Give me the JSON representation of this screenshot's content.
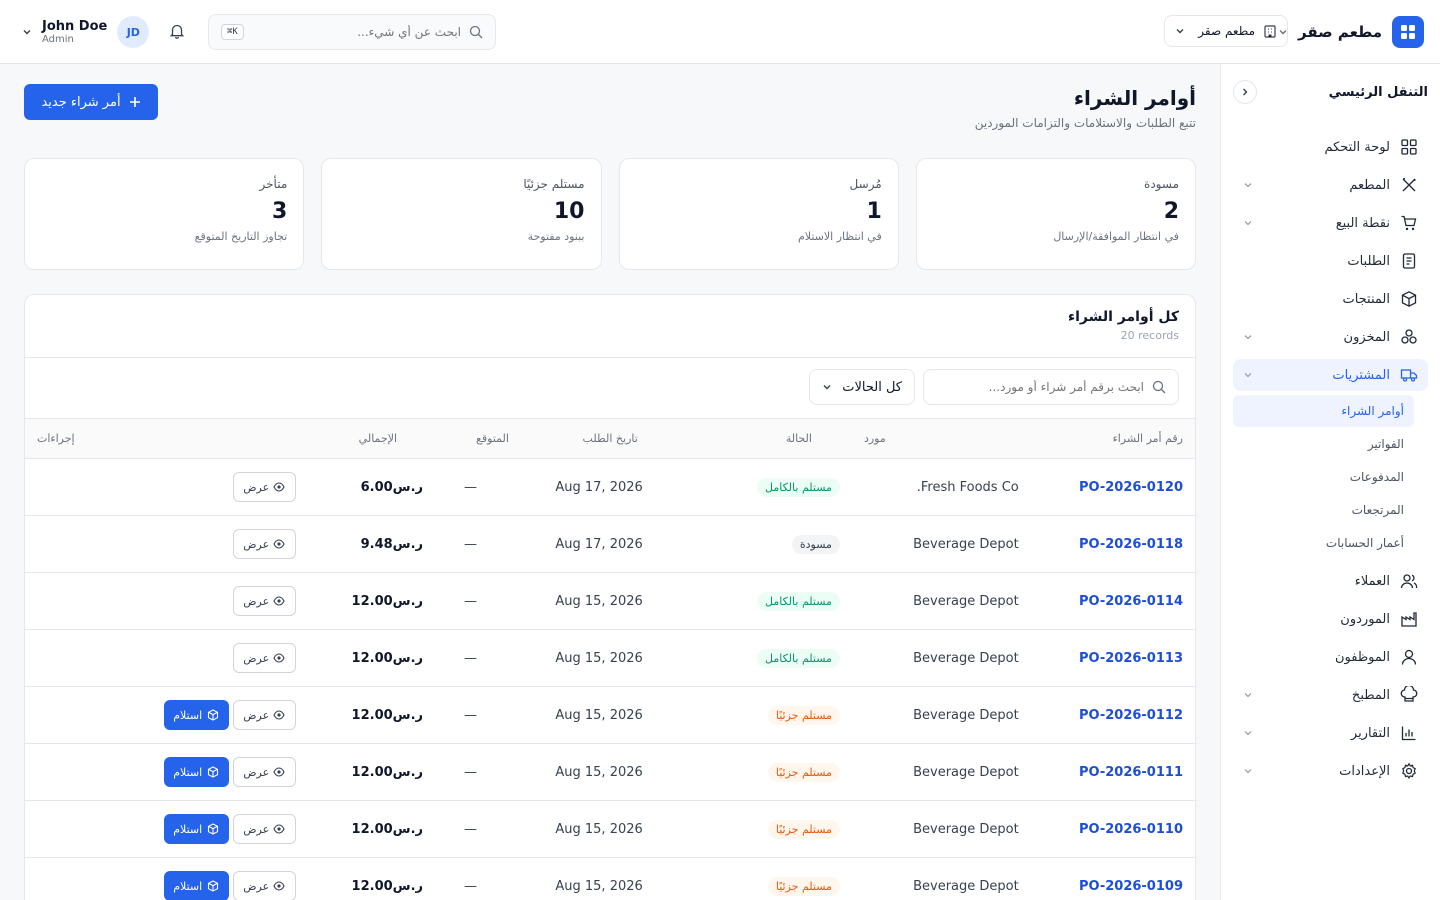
{
  "topbar": {
    "brand_name": "مطعم صقر",
    "branch": "مطعم صقر",
    "search_placeholder": "ابحث عن أي شيء...",
    "kbd": "K⌘",
    "user_name": "John Doe",
    "user_role": "Admin",
    "avatar": "JD"
  },
  "sidebar": {
    "title": "التنقل الرئيسي",
    "items": [
      {
        "label": "لوحة التحكم",
        "icon": "dashboard-icon"
      },
      {
        "label": "المطعم",
        "icon": "utensils-icon"
      },
      {
        "label": "نقطة البيع",
        "icon": "cart-icon"
      },
      {
        "label": "الطلبات",
        "icon": "receipt-icon"
      },
      {
        "label": "المنتجات",
        "icon": "box-icon"
      },
      {
        "label": "المخزون",
        "icon": "boxes-icon"
      },
      {
        "label": "المشتريات",
        "icon": "truck-icon"
      },
      {
        "label": "العملاء",
        "icon": "users-icon"
      },
      {
        "label": "الموردون",
        "icon": "factory-icon"
      },
      {
        "label": "الموظفون",
        "icon": "user-icon"
      },
      {
        "label": "المطبخ",
        "icon": "chef-hat-icon"
      },
      {
        "label": "التقارير",
        "icon": "chart-icon"
      },
      {
        "label": "الإعدادات",
        "icon": "gear-icon"
      }
    ],
    "purchases_sub": [
      "أوامر الشراء",
      "الفواتير",
      "المدفوعات",
      "المرتجعات",
      "أعمار الحسابات"
    ]
  },
  "page": {
    "title": "أوامر الشراء",
    "subtitle": "تتبع الطلبات والاستلامات والتزامات الموردين",
    "new_button": "أمر شراء جديد"
  },
  "stats": [
    {
      "label": "مسودة",
      "value": "2",
      "note": "في انتظار الموافقة/الإرسال"
    },
    {
      "label": "مُرسل",
      "value": "1",
      "note": "في انتظار الاستلام"
    },
    {
      "label": "مستلم جزئيًا",
      "value": "10",
      "note": "ببنود مفتوحة"
    },
    {
      "label": "متأخر",
      "value": "3",
      "note": "تجاوز التاريخ المتوقع"
    }
  ],
  "table_card": {
    "title": "كل أوامر الشراء",
    "count": "20 records",
    "search_placeholder": "ابحث برقم أمر شراء أو مورد...",
    "status_filter": "كل الحالات",
    "columns": [
      "رقم أمر الشراء",
      "مورد",
      "الحالة",
      "تاريخ الطلب",
      "المتوقع",
      "الإجمالي",
      "إجراءات"
    ],
    "view_label": "عرض",
    "receive_label": "استلام",
    "rows": [
      {
        "po": "PO-2026-0120",
        "supplier": "Fresh Foods Co.",
        "status": "مستلم بالكامل",
        "status_type": "full",
        "date": "Aug 17, 2026",
        "expected": "—",
        "total": "ر.س6.00",
        "receive": false
      },
      {
        "po": "PO-2026-0118",
        "supplier": "Beverage Depot",
        "status": "مسودة",
        "status_type": "draft",
        "date": "Aug 17, 2026",
        "expected": "—",
        "total": "ر.س9.48",
        "receive": false
      },
      {
        "po": "PO-2026-0114",
        "supplier": "Beverage Depot",
        "status": "مستلم بالكامل",
        "status_type": "full",
        "date": "Aug 15, 2026",
        "expected": "—",
        "total": "ر.س12.00",
        "receive": false
      },
      {
        "po": "PO-2026-0113",
        "supplier": "Beverage Depot",
        "status": "مستلم بالكامل",
        "status_type": "full",
        "date": "Aug 15, 2026",
        "expected": "—",
        "total": "ر.س12.00",
        "receive": false
      },
      {
        "po": "PO-2026-0112",
        "supplier": "Beverage Depot",
        "status": "مستلم جزئيًا",
        "status_type": "part",
        "date": "Aug 15, 2026",
        "expected": "—",
        "total": "ر.س12.00",
        "receive": true
      },
      {
        "po": "PO-2026-0111",
        "supplier": "Beverage Depot",
        "status": "مستلم جزئيًا",
        "status_type": "part",
        "date": "Aug 15, 2026",
        "expected": "—",
        "total": "ر.س12.00",
        "receive": true
      },
      {
        "po": "PO-2026-0110",
        "supplier": "Beverage Depot",
        "status": "مستلم جزئيًا",
        "status_type": "part",
        "date": "Aug 15, 2026",
        "expected": "—",
        "total": "ر.س12.00",
        "receive": true
      },
      {
        "po": "PO-2026-0109",
        "supplier": "Beverage Depot",
        "status": "مستلم جزئيًا",
        "status_type": "part",
        "date": "Aug 15, 2026",
        "expected": "—",
        "total": "ر.س12.00",
        "receive": true
      }
    ]
  },
  "colors": {
    "accent": "#2563eb",
    "success": "#059669",
    "warning": "#ea580c"
  }
}
